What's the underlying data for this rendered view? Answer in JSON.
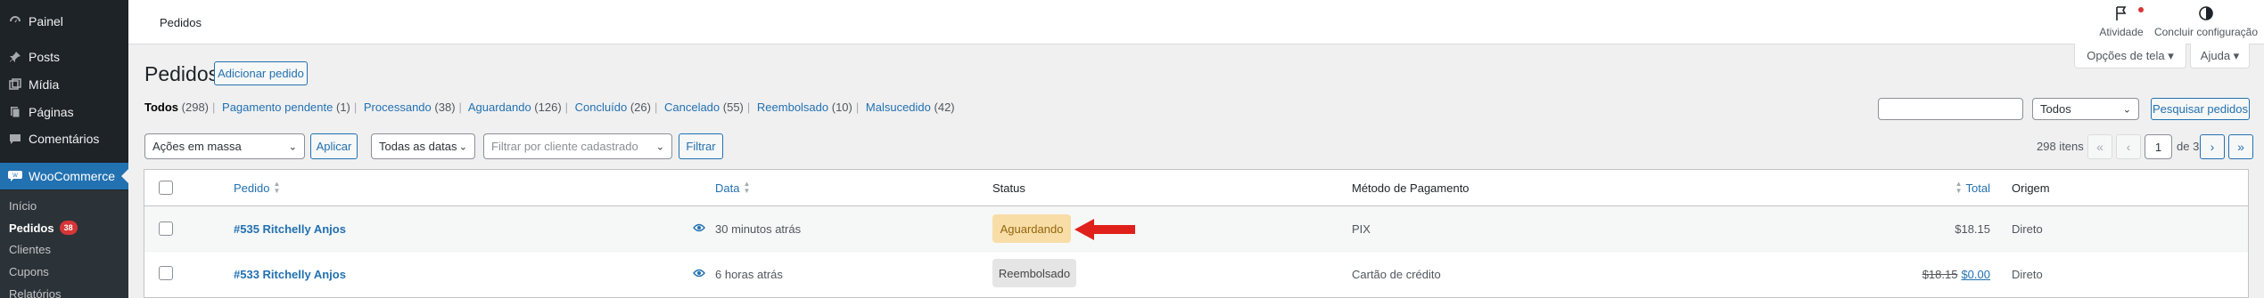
{
  "sidebar": {
    "items": [
      {
        "label": "Painel",
        "icon": "dashboard-icon"
      },
      {
        "label": "Posts",
        "icon": "pin-icon"
      },
      {
        "label": "Mídia",
        "icon": "media-icon"
      },
      {
        "label": "Páginas",
        "icon": "pages-icon"
      },
      {
        "label": "Comentários",
        "icon": "comments-icon"
      },
      {
        "label": "WooCommerce",
        "icon": "woocommerce-icon"
      }
    ],
    "submenu": [
      {
        "label": "Início"
      },
      {
        "label": "Pedidos",
        "badge": "38"
      },
      {
        "label": "Clientes"
      },
      {
        "label": "Cupons"
      },
      {
        "label": "Relatórios"
      }
    ]
  },
  "header": {
    "breadcrumb": "Pedidos",
    "activity_label": "Atividade",
    "setup_label": "Concluir configuração",
    "screen_options": "Opções de tela ▾",
    "help": "Ajuda ▾"
  },
  "page": {
    "title": "Pedidos",
    "add_button": "Adicionar pedido"
  },
  "filters_nav": [
    {
      "label": "Todos",
      "count": "(298)"
    },
    {
      "label": "Pagamento pendente",
      "count": "(1)"
    },
    {
      "label": "Processando",
      "count": "(38)"
    },
    {
      "label": "Aguardando",
      "count": "(126)"
    },
    {
      "label": "Concluído",
      "count": "(26)"
    },
    {
      "label": "Cancelado",
      "count": "(55)"
    },
    {
      "label": "Reembolsado",
      "count": "(10)"
    },
    {
      "label": "Malsucedido",
      "count": "(42)"
    }
  ],
  "search": {
    "value": "",
    "status_select": "Todos",
    "button": "Pesquisar pedidos"
  },
  "toolbar": {
    "bulk_actions": "Ações em massa",
    "apply": "Aplicar",
    "dates": "Todas as datas",
    "customer_placeholder": "Filtrar por cliente cadastrado",
    "filter": "Filtrar"
  },
  "pagination": {
    "items": "298 itens",
    "first": "«",
    "prev": "‹",
    "current": "1",
    "of": "de 3",
    "next": "›",
    "last": "»"
  },
  "table": {
    "headers": {
      "order": "Pedido",
      "date": "Data",
      "status": "Status",
      "payment": "Método de Pagamento",
      "total": "Total",
      "origin": "Origem"
    },
    "rows": [
      {
        "order": "#535 Ritchelly Anjos",
        "date": "30 minutos atrás",
        "status": "Aguardando",
        "payment": "PIX",
        "total": "$18.15",
        "total_old": "",
        "origin": "Direto"
      },
      {
        "order": "#533 Ritchelly Anjos",
        "date": "6 horas atrás",
        "status": "Reembolsado",
        "payment": "Cartão de crédito",
        "total": "$0.00",
        "total_old": "$18.15",
        "origin": "Direto"
      }
    ]
  },
  "colors": {
    "sidebar": "#1d2327",
    "accent": "#2271b1",
    "status_aguardando": "#f8dda7",
    "status_reembolsado": "#e5e5e5",
    "annotation_arrow": "#e0201b"
  }
}
